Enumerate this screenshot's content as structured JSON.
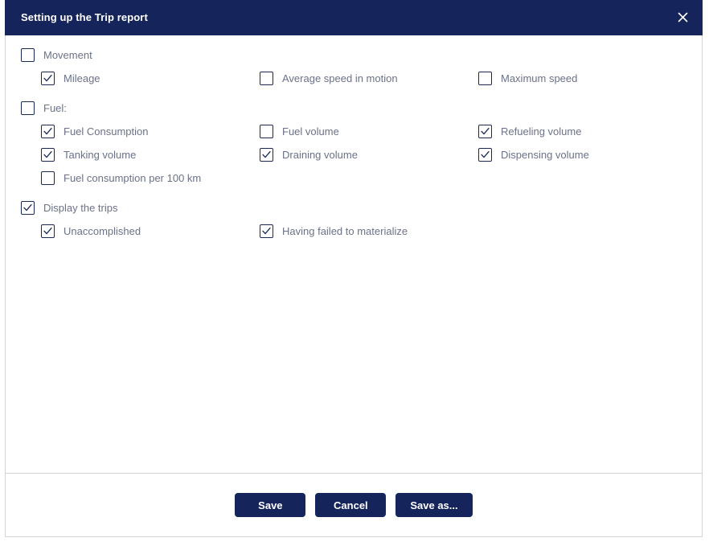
{
  "dialog": {
    "title": "Setting up the Trip report",
    "close_icon": "close-icon",
    "accent_color": "#15255c",
    "label_color": "#6b7288",
    "border_color": "#d2d4d8"
  },
  "groups": [
    {
      "key": "movement",
      "parent": {
        "label": "Movement",
        "checked": false
      },
      "rows": [
        [
          {
            "label": "Mileage",
            "checked": true
          },
          {
            "label": "Average speed in motion",
            "checked": false
          },
          {
            "label": "Maximum speed",
            "checked": false
          }
        ]
      ]
    },
    {
      "key": "fuel",
      "parent": {
        "label": "Fuel:",
        "checked": false
      },
      "rows": [
        [
          {
            "label": "Fuel Consumption",
            "checked": true
          },
          {
            "label": "Fuel volume",
            "checked": false
          },
          {
            "label": "Refueling volume",
            "checked": true
          }
        ],
        [
          {
            "label": "Tanking volume",
            "checked": true
          },
          {
            "label": "Draining volume",
            "checked": true
          },
          {
            "label": "Dispensing volume",
            "checked": true
          }
        ],
        [
          {
            "label": "Fuel consumption per 100 km",
            "checked": false
          },
          null,
          null
        ]
      ]
    },
    {
      "key": "display-the-trips",
      "parent": {
        "label": "Display the trips",
        "checked": true
      },
      "rows": [
        [
          {
            "label": "Unaccomplished",
            "checked": true
          },
          {
            "label": "Having failed to materialize",
            "checked": true
          },
          null
        ]
      ]
    }
  ],
  "footer": {
    "buttons": [
      {
        "key": "save",
        "label": "Save"
      },
      {
        "key": "cancel",
        "label": "Cancel"
      },
      {
        "key": "save-as",
        "label": "Save as..."
      }
    ]
  }
}
